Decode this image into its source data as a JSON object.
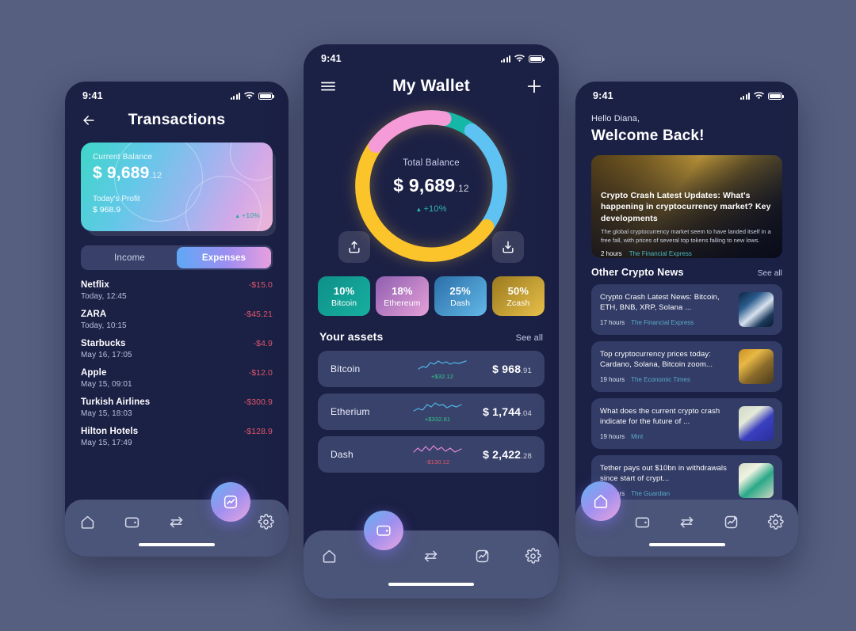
{
  "status_bar": {
    "time": "9:41"
  },
  "transactions_screen": {
    "title": "Transactions",
    "balance_card": {
      "balance_label": "Current Balance",
      "balance_amount": "$ 9,689",
      "balance_cents": ".12",
      "profit_label": "Today's Profit",
      "profit_value": "$ 968.9",
      "change_pct": "+10%",
      "gradient_from": "#3ed6c8",
      "gradient_to": "#eeb7d8"
    },
    "toggle": {
      "income": "Income",
      "expenses": "Expenses",
      "active": "Expenses"
    },
    "list": [
      {
        "name": "Netflix",
        "date": "Today, 12:45",
        "amount": "-$15.0"
      },
      {
        "name": "ZARA",
        "date": "Today, 10:15",
        "amount": "-$45.21"
      },
      {
        "name": "Starbucks",
        "date": "May 16, 17:05",
        "amount": "-$4.9"
      },
      {
        "name": "Apple",
        "date": "May 15, 09:01",
        "amount": "-$12.0"
      },
      {
        "name": "Turkish Airlines",
        "date": "May 15, 18:03",
        "amount": "-$300.9"
      },
      {
        "name": "Hilton Hotels",
        "date": "May 15, 17:49",
        "amount": "-$128.9"
      }
    ],
    "nav": {
      "items": [
        "home-icon",
        "wallet-icon",
        "swap-icon",
        "settings-icon"
      ],
      "fab": "chart-icon"
    }
  },
  "wallet_screen": {
    "title": "My Wallet",
    "menu_icon": "hamburger-icon",
    "add_icon": "plus-icon",
    "donut": {
      "total_label": "Total Balance",
      "total_amount": "$ 9,689",
      "total_cents": ".12",
      "change_pct": "+10%",
      "segments": [
        {
          "name": "Bitcoin",
          "pct": 10,
          "color": "#15b8a6"
        },
        {
          "name": "Ethereum",
          "pct": 18,
          "color": "#f49bd8"
        },
        {
          "name": "Dash",
          "pct": 25,
          "color": "#5ec2f2"
        },
        {
          "name": "Zcash",
          "pct": 50,
          "color": "#fbc42a"
        }
      ]
    },
    "send_label": "send-icon",
    "receive_label": "receive-icon",
    "chips": [
      {
        "pct": "10%",
        "name": "Bitcoin",
        "from": "#0f8f88",
        "to": "#16b0a0"
      },
      {
        "pct": "18%",
        "name": "Ethereum",
        "from": "#8e5fb0",
        "to": "#e6a0d8"
      },
      {
        "pct": "25%",
        "name": "Dash",
        "from": "#2a6fa8",
        "to": "#63b8e8"
      },
      {
        "pct": "50%",
        "name": "Zcash",
        "from": "#9a7a1e",
        "to": "#e8c04a"
      }
    ],
    "assets_title": "Your assets",
    "see_all": "See all",
    "assets": [
      {
        "name": "Bitcoin",
        "delta": "+$32.12",
        "delta_color": "#35c98a",
        "spark_color": "#4fb8e8",
        "price": "$ 968",
        "cents": ".91",
        "trend": "up"
      },
      {
        "name": "Etherium",
        "delta": "+$332.61",
        "delta_color": "#35c98a",
        "spark_color": "#4fb8e8",
        "price": "$ 1,744",
        "cents": ".04",
        "trend": "up"
      },
      {
        "name": "Dash",
        "delta": "-$130.12",
        "delta_color": "#e2566b",
        "spark_color": "#e08ad8",
        "price": "$ 2,422",
        "cents": ".28",
        "trend": "down"
      }
    ],
    "nav": {
      "items": [
        "home-icon",
        "swap-icon",
        "chart-icon",
        "settings-icon"
      ],
      "fab": "wallet-icon"
    }
  },
  "news_screen": {
    "hello": "Hello Diana,",
    "welcome": "Welcome Back!",
    "hero": {
      "title": "Crypto Crash Latest Updates: What's happening in cryptocurrency market? Key developments",
      "desc": "The global cryptocurrency market seem to have landed itself in a free fall, with prices of several top tokens falling to new lows.",
      "time": "2 hours",
      "source": "The Financial Express"
    },
    "section_title": "Other Crypto News",
    "see_all": "See all",
    "items": [
      {
        "title": "Crypto Crash Latest News: Bitcoin, ETH, BNB, XRP, Solana ...",
        "time": "17 hours",
        "source": "The Financial Express"
      },
      {
        "title": "Top cryptocurrency prices today: Cardano, Solana, Bitcoin zoom...",
        "time": "19 hours",
        "source": "The Economic Times"
      },
      {
        "title": "What does the current crypto crash indicate for the future of ...",
        "time": "19 hours",
        "source": "Mint"
      },
      {
        "title": "Tether pays out $10bn in withdrawals since start of crypt...",
        "time": "19 hours",
        "source": "The Guardian"
      }
    ],
    "nav": {
      "items": [
        "wallet-icon",
        "swap-icon",
        "chart-icon",
        "settings-icon"
      ],
      "fab": "home-icon"
    }
  }
}
